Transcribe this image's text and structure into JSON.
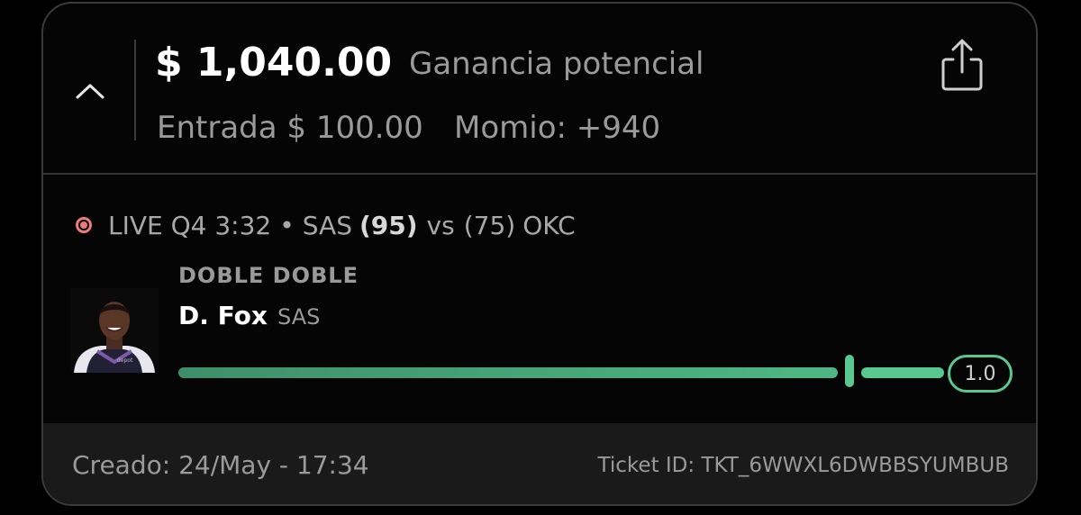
{
  "ticket": {
    "amount": "$ 1,040.00",
    "amount_label": "Ganancia potencial",
    "entry": "Entrada $ 100.00",
    "odds": "Momio: +940"
  },
  "game": {
    "status": "LIVE Q4 3:32",
    "separator": "•",
    "home_team": "SAS",
    "home_score": "(95)",
    "vs": "vs",
    "away_score": "(75)",
    "away_team": "OKC"
  },
  "selection": {
    "market": "DOBLE DOBLE",
    "player": "D. Fox",
    "team": "SAS",
    "target": "1.0",
    "progress": 0.87
  },
  "footer": {
    "created": "Creado: 24/May - 17:34",
    "ticket_id": "Ticket ID: TKT_6WWXL6DWBBSYUMBUB"
  },
  "icons": {
    "collapse": "chevron-up-icon",
    "share": "share-icon",
    "live": "live-dot-icon"
  },
  "colors": {
    "accent": "#5ac792",
    "live": "#ee7b7b",
    "background": "#000000"
  }
}
